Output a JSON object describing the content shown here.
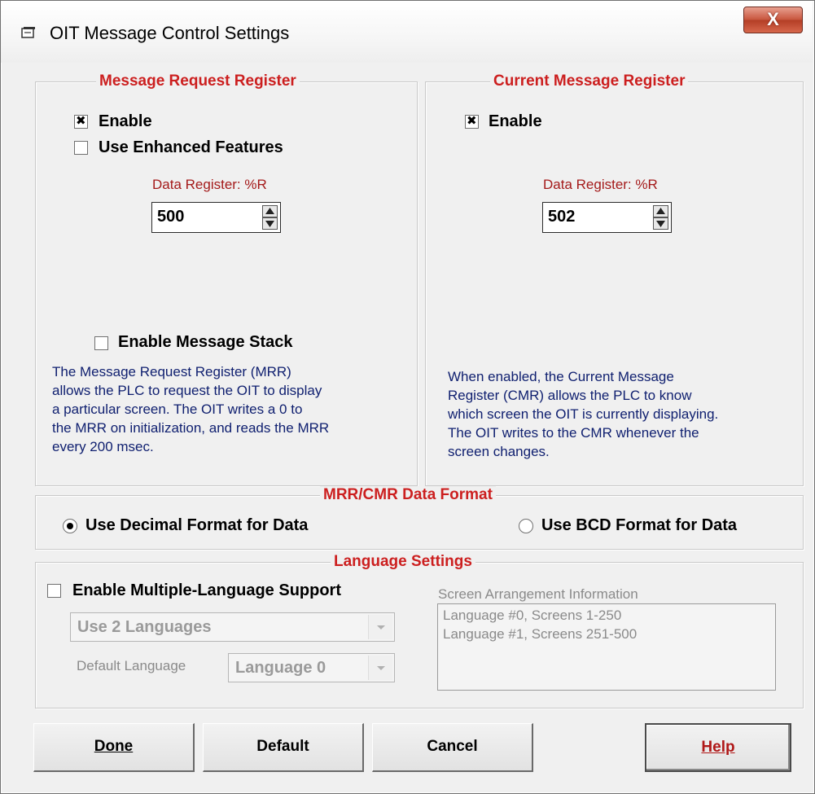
{
  "window": {
    "title": "OIT Message Control Settings",
    "close_label": "X"
  },
  "mrr": {
    "legend": "Message Request Register",
    "enable_label": "Enable",
    "enable_checked": true,
    "enhanced_label": "Use Enhanced Features",
    "enhanced_checked": false,
    "data_register_label": "Data Register: %R",
    "data_register_value": "500",
    "stack_label": "Enable Message Stack",
    "stack_checked": false,
    "description": [
      "The Message Request Register (MRR)",
      "allows the PLC to request the OIT to display",
      "a particular screen.   The OIT writes a 0 to",
      "the MRR on initialization, and reads the MRR",
      "every 200 msec."
    ]
  },
  "cmr": {
    "legend": "Current Message Register",
    "enable_label": "Enable",
    "enable_checked": true,
    "data_register_label": "Data Register: %R",
    "data_register_value": "502",
    "description": [
      "When enabled, the Current Message",
      "Register (CMR) allows the PLC to know",
      "which screen the OIT is currently displaying.",
      "The OIT writes to the CMR whenever the",
      "screen changes."
    ]
  },
  "format": {
    "legend": "MRR/CMR Data Format",
    "decimal_label": "Use Decimal Format for Data",
    "bcd_label": "Use BCD Format for Data",
    "selected": "decimal"
  },
  "language": {
    "legend": "Language Settings",
    "enable_label": "Enable Multiple-Language Support",
    "enable_checked": false,
    "count_select": "Use 2 Languages",
    "default_label": "Default Language",
    "default_select": "Language 0",
    "arrangement_label": "Screen Arrangement Information",
    "arrangement_items": [
      "Language #0, Screens 1-250",
      "Language #1, Screens 251-500"
    ]
  },
  "buttons": {
    "done": "Done",
    "default": "Default",
    "cancel": "Cancel",
    "help": "Help"
  },
  "colors": {
    "legend_red": "#cc1f1f",
    "description_blue": "#102070",
    "disabled_gray": "#8a8a8a"
  }
}
